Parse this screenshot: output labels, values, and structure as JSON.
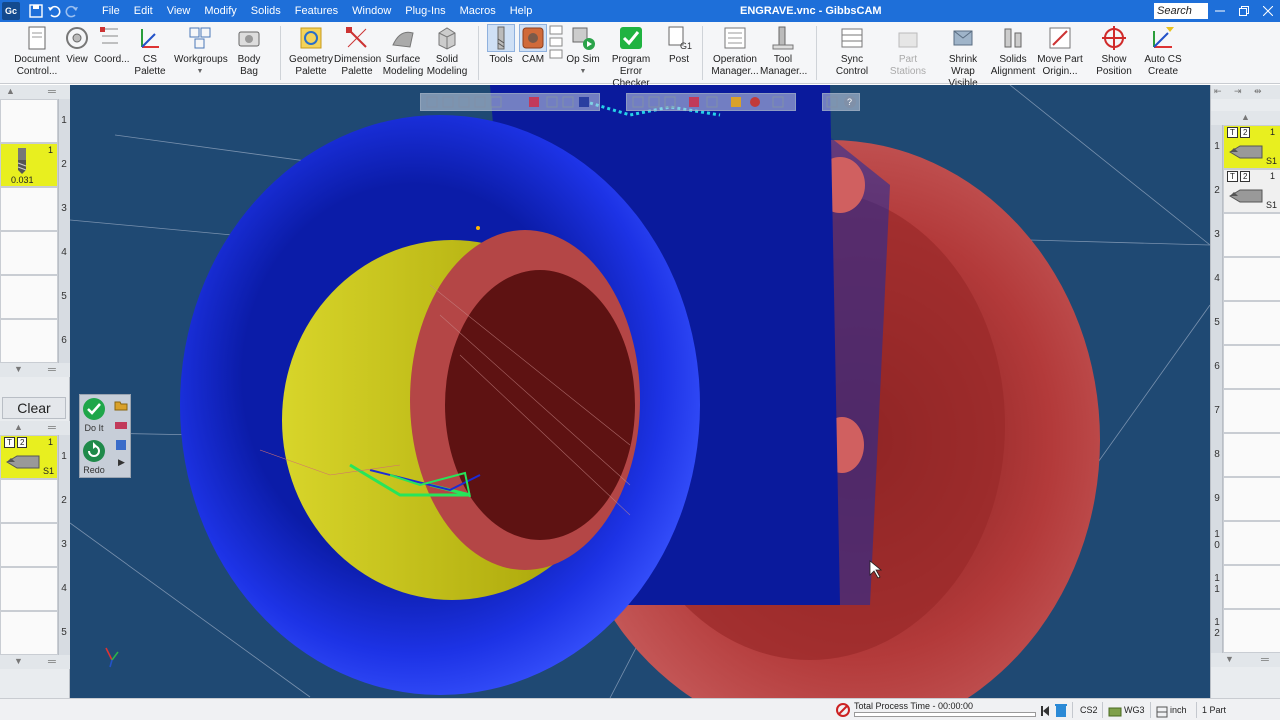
{
  "app": {
    "logo": "Gc",
    "title": "ENGRAVE.vnc - GibbsCAM"
  },
  "quick_access": [
    "save-icon",
    "undo-icon",
    "redo-icon"
  ],
  "menu": [
    "File",
    "Edit",
    "View",
    "Modify",
    "Solids",
    "Features",
    "Window",
    "Plug-Ins",
    "Macros",
    "Help"
  ],
  "search": {
    "placeholder": "Search"
  },
  "ribbon": {
    "document_control": {
      "line1": "Document",
      "line2": "Control..."
    },
    "view": "View",
    "coord": "Coord...",
    "cs_palette": "CS Palette",
    "workgroups": "Workgroups",
    "body_bag": "Body Bag",
    "geometry_palette": {
      "line1": "Geometry",
      "line2": "Palette"
    },
    "dimension_palette": {
      "line1": "Dimension",
      "line2": "Palette"
    },
    "surface_modeling": {
      "line1": "Surface",
      "line2": "Modeling"
    },
    "solid_modeling": {
      "line1": "Solid",
      "line2": "Modeling"
    },
    "tools": "Tools",
    "cam": "CAM",
    "op_sim": "Op Sim",
    "program_error_checker": {
      "line1": "Program Error",
      "line2": "Checker"
    },
    "post": "Post",
    "operation_manager": {
      "line1": "Operation",
      "line2": "Manager..."
    },
    "tool_manager": {
      "line1": "Tool",
      "line2": "Manager..."
    },
    "sync_control": "Sync Control",
    "part_stations": "Part Stations",
    "shrink_wrap": {
      "line1": "Shrink Wrap",
      "line2": "Visible"
    },
    "solids_alignment": {
      "line1": "Solids",
      "line2": "Alignment"
    },
    "move_part_origin": {
      "line1": "Move Part",
      "line2": "Origin..."
    },
    "show_position": "Show Position",
    "auto_cs_create": {
      "line1": "Auto CS",
      "line2": "Create"
    }
  },
  "left_tools": {
    "slots": [
      "1",
      "2",
      "3",
      "4",
      "5",
      "6"
    ],
    "tool2": {
      "num": "1",
      "value": "0.031"
    }
  },
  "process": {
    "clear": "Clear",
    "do_it": "Do It",
    "redo": "Redo",
    "slots": [
      "1",
      "2",
      "3",
      "4",
      "5"
    ],
    "tile": {
      "t": "T",
      "n": "2",
      "num": "1",
      "s": "S1"
    }
  },
  "right_ops": {
    "slots": [
      "1",
      "2",
      "3",
      "4",
      "5",
      "6",
      "7",
      "8",
      "9",
      "1 0",
      "1 1",
      "1 2"
    ],
    "tile1": {
      "t": "T",
      "n": "2",
      "num": "1",
      "s": "S1"
    },
    "tile2": {
      "t": "T",
      "n": "2",
      "num": "1",
      "s": "S1"
    }
  },
  "status": {
    "process_time": "Total Process Time - 00:00:00",
    "cs": "CS2",
    "wg": "WG3",
    "units": "inch",
    "parts": "1 Part"
  },
  "colors": {
    "title_bar": "#1e6fd9",
    "viewport_bg": "#1f4973",
    "tool_yellow": "#e8ef1f",
    "stock_blue": "#1b2ee0",
    "part_red": "#b63a3a"
  }
}
